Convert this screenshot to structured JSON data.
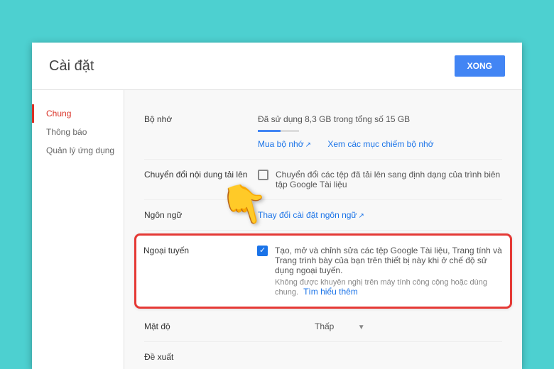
{
  "header": {
    "title": "Cài đặt",
    "done": "XONG"
  },
  "sidebar": {
    "items": [
      {
        "label": "Chung",
        "active": true
      },
      {
        "label": "Thông báo",
        "active": false
      },
      {
        "label": "Quản lý ứng dụng",
        "active": false
      }
    ]
  },
  "storage": {
    "label": "Bộ nhớ",
    "usage_text": "Đã sử dụng 8,3 GB trong tổng số 15 GB",
    "progress_pct": 55,
    "buy_link": "Mua bộ nhớ",
    "view_link": "Xem các mục chiếm bộ nhớ"
  },
  "uploads": {
    "label": "Chuyển đổi nội dung tải lên",
    "desc": "Chuyển đổi các tệp đã tải lên sang định dạng của trình biên tập Google Tài liệu"
  },
  "language": {
    "label": "Ngôn ngữ",
    "link": "Thay đổi cài đặt ngôn ngữ"
  },
  "offline": {
    "label": "Ngoại tuyến",
    "desc": "Tạo, mở và chỉnh sửa các tệp Google Tài liệu, Trang tính và Trang trình bày của bạn trên thiết bị này khi ở chế độ sử dụng ngoại tuyến.",
    "subtext": "Không được khuyên nghị trên máy tính công cộng hoặc dùng chung.",
    "learn": "Tìm hiểu thêm"
  },
  "density": {
    "label": "Mật độ",
    "value": "Thấp"
  },
  "suggest": {
    "label": "Đề xuất"
  }
}
